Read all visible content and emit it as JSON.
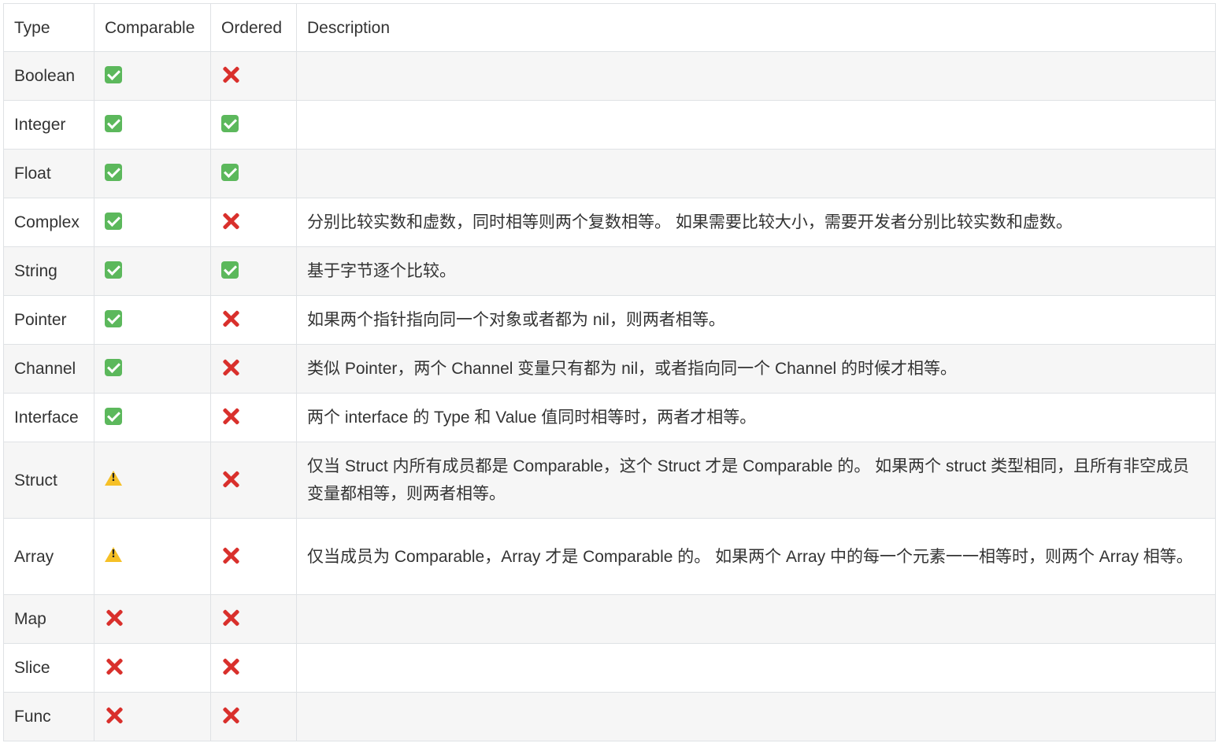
{
  "table": {
    "headers": {
      "type": "Type",
      "comparable": "Comparable",
      "ordered": "Ordered",
      "description": "Description"
    },
    "rows": [
      {
        "type": "Boolean",
        "comparable": "yes",
        "ordered": "no",
        "description": ""
      },
      {
        "type": "Integer",
        "comparable": "yes",
        "ordered": "yes",
        "description": ""
      },
      {
        "type": "Float",
        "comparable": "yes",
        "ordered": "yes",
        "description": ""
      },
      {
        "type": "Complex",
        "comparable": "yes",
        "ordered": "no",
        "description": "分别比较实数和虚数，同时相等则两个复数相等。 如果需要比较大小，需要开发者分别比较实数和虚数。"
      },
      {
        "type": "String",
        "comparable": "yes",
        "ordered": "yes",
        "description": "基于字节逐个比较。"
      },
      {
        "type": "Pointer",
        "comparable": "yes",
        "ordered": "no",
        "description": "如果两个指针指向同一个对象或者都为 nil，则两者相等。"
      },
      {
        "type": "Channel",
        "comparable": "yes",
        "ordered": "no",
        "description": "类似 Pointer，两个 Channel 变量只有都为 nil，或者指向同一个 Channel 的时候才相等。"
      },
      {
        "type": "Interface",
        "comparable": "yes",
        "ordered": "no",
        "description": "两个 interface 的 Type 和 Value 值同时相等时，两者才相等。"
      },
      {
        "type": "Struct",
        "comparable": "warning",
        "ordered": "no",
        "description": "仅当 Struct 内所有成员都是 Comparable，这个 Struct 才是 Comparable 的。 如果两个 struct 类型相同，且所有非空成员变量都相等，则两者相等。"
      },
      {
        "type": "Array",
        "comparable": "warning",
        "ordered": "no",
        "description": "仅当成员为 Comparable，Array 才是 Comparable 的。 如果两个 Array 中的每一个元素一一相等时，则两个 Array 相等。"
      },
      {
        "type": "Map",
        "comparable": "no",
        "ordered": "no",
        "description": ""
      },
      {
        "type": "Slice",
        "comparable": "no",
        "ordered": "no",
        "description": ""
      },
      {
        "type": "Func",
        "comparable": "no",
        "ordered": "no",
        "description": ""
      }
    ]
  },
  "icons": {
    "yes": "check-mark-icon",
    "no": "cross-mark-icon",
    "warning": "warning-icon"
  },
  "colors": {
    "check": "#5cb85c",
    "cross": "#d9302c",
    "warning": "#f6c026",
    "border": "#dfe2e5",
    "stripe": "#f6f6f6"
  }
}
